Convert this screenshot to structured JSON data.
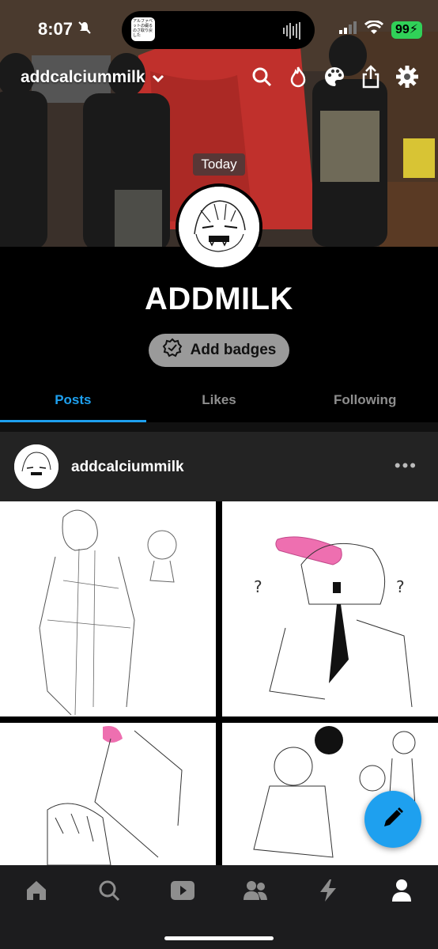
{
  "status_bar": {
    "time": "8:07",
    "island_app_text": "アルファベットの綴るのさ取り戻した",
    "battery": "99"
  },
  "toolbar": {
    "blog_name": "addcalciummilk",
    "icons": [
      "search-icon",
      "fire-icon",
      "palette-icon",
      "share-icon",
      "gear-icon"
    ]
  },
  "header": {
    "today_label": "Today"
  },
  "profile": {
    "title": "ADDMILK",
    "badges_button": "Add badges"
  },
  "tabs": [
    {
      "label": "Posts",
      "active": true
    },
    {
      "label": "Likes",
      "active": false
    },
    {
      "label": "Following",
      "active": false
    }
  ],
  "post": {
    "author": "addcalciummilk",
    "more": "•••",
    "sketch_text": "?"
  },
  "bottom_nav": [
    "home-icon",
    "search-icon",
    "video-icon",
    "people-icon",
    "lightning-icon",
    "account-icon"
  ],
  "colors": {
    "accent": "#1ea0ef",
    "battery": "#30d158",
    "badge_button": "#9a9a9a",
    "post_header": "#232323",
    "nav_bg": "#1c1c1e"
  }
}
